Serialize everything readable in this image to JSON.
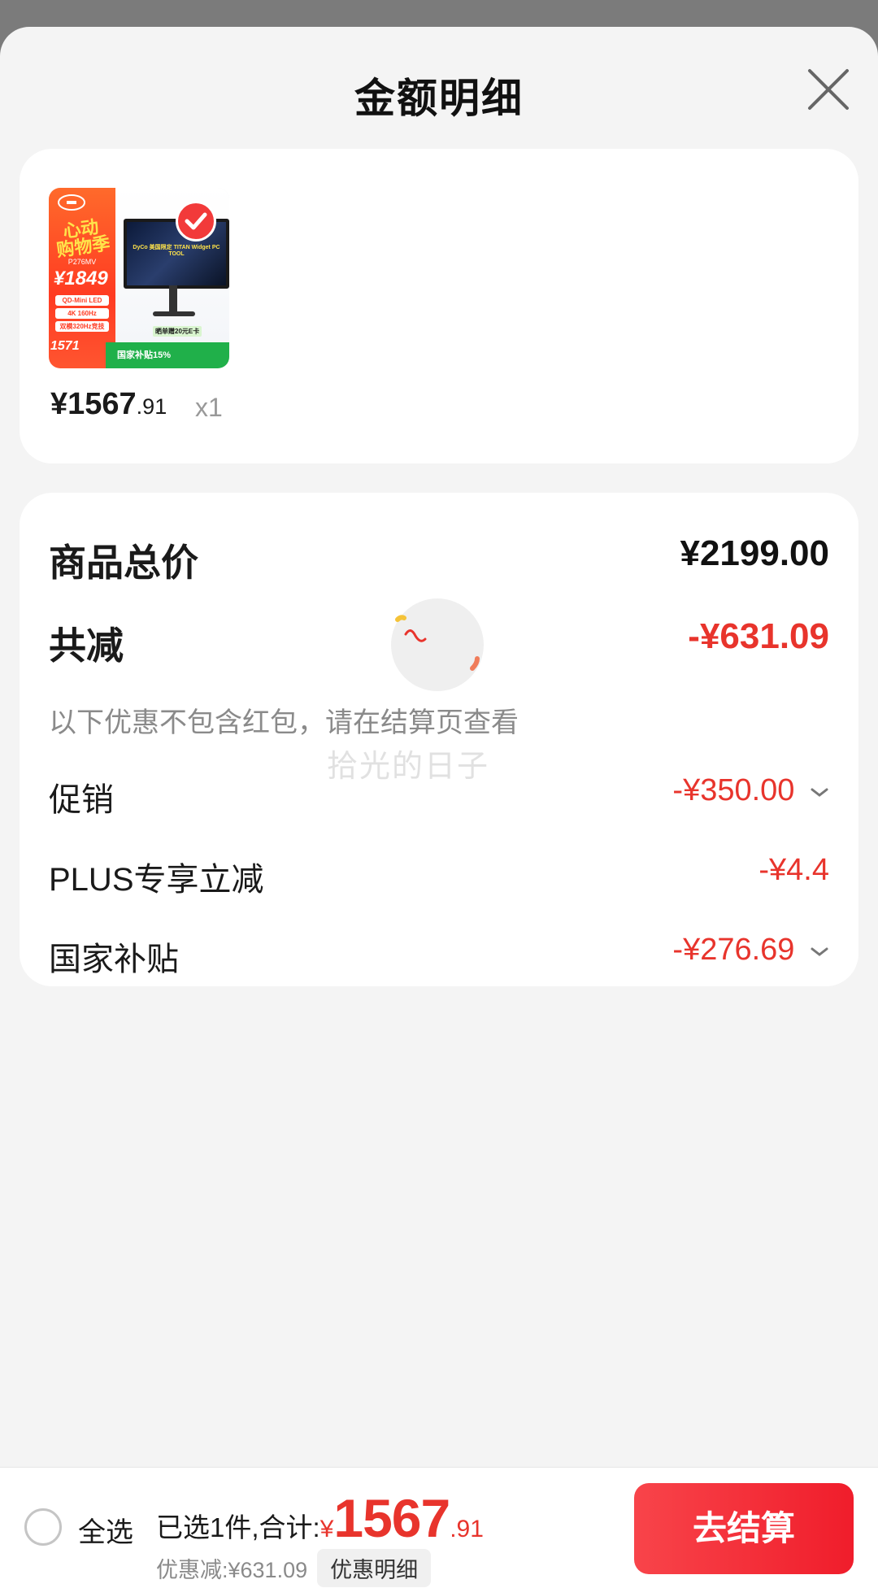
{
  "sheet": {
    "title": "金额明细"
  },
  "product": {
    "price_int": "¥1567",
    "price_dec": ".91",
    "quantity": "x1",
    "image": {
      "promo_text": "心动\n购物季",
      "model": "P276MV",
      "big_price": "¥1849",
      "tag_1": "QD-Mini LED",
      "tag_2": "4K 160Hz",
      "tag_3": "双模320Hz竞技",
      "low_price": "1571",
      "monitor_caption": "DyCo 美国限定 TITAN Widget PC TOOL",
      "gift": "晒单赠20元E卡",
      "subsidy_bar": "国家补贴15%"
    }
  },
  "summary": {
    "total_label": "商品总价",
    "total_value": "¥2199.00",
    "reduce_label": "共减",
    "reduce_value": "-¥631.09",
    "note": "以下优惠不包含红包，请在结算页查看",
    "watermark": "拾光的日子",
    "items": [
      {
        "label": "促销",
        "value": "-¥350.00",
        "expandable": true
      },
      {
        "label": "PLUS专享立减",
        "value": "-¥4.4",
        "expandable": false
      },
      {
        "label": "国家补贴",
        "value": "-¥276.69",
        "expandable": true
      }
    ]
  },
  "bottom_bar": {
    "select_all": "全选",
    "selected_text": "已选1件,合计:",
    "sum_yen": "¥",
    "sum_int": "1567",
    "sum_dec": ".91",
    "discount_text": "优惠减:¥631.09",
    "discount_detail_button": "优惠明细",
    "checkout_button": "去结算"
  },
  "colors": {
    "accent_red": "#e8342c",
    "checkout_button": "#f01d2b",
    "background": "#f4f4f4",
    "overlay": "#7b7b7b"
  },
  "icons": {
    "close": "close-icon",
    "chevron": "chevron-down-icon",
    "radio": "radio-unchecked-icon",
    "loading": "loading-spinner-icon"
  }
}
